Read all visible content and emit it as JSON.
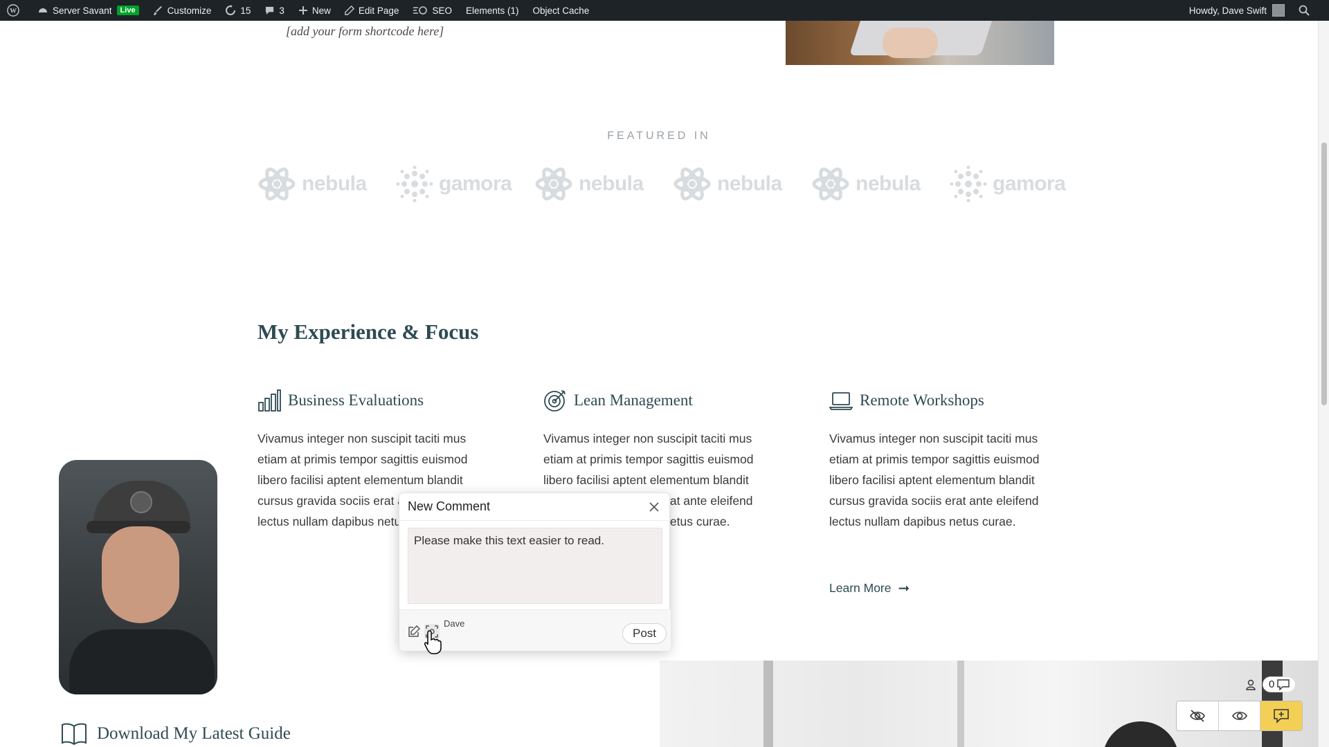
{
  "admin_bar": {
    "site_name": "Server Savant",
    "live_badge": "Live",
    "customize": "Customize",
    "updates_count": "15",
    "comments_count": "3",
    "new_label": "New",
    "edit_page": "Edit Page",
    "seo": "SEO",
    "elements": "Elements (1)",
    "object_cache": "Object Cache",
    "greeting": "Howdy, Dave Swift"
  },
  "page": {
    "shortcode_placeholder": "[add your form shortcode here]",
    "featured_title": "FEATURED IN",
    "logos": [
      "nebula",
      "gamora",
      "nebula",
      "nebula",
      "nebula",
      "gamora"
    ],
    "experience_heading": "My Experience & Focus",
    "columns": [
      {
        "icon": "bar-chart-icon",
        "title": "Business Evaluations",
        "body": "Vivamus integer non suscipit taciti mus etiam at primis tempor sagittis euismod libero facilisi aptent elementum blandit cursus gravida sociis erat ante eleifend lectus nullam dapibus netus curae."
      },
      {
        "icon": "target-icon",
        "title": "Lean Management",
        "body": "Vivamus integer non suscipit taciti mus etiam at primis tempor sagittis euismod libero facilisi aptent elementum blandit cursus gravida sociis erat ante eleifend lectus nullam dapibus netus curae."
      },
      {
        "icon": "laptop-icon",
        "title": "Remote Workshops",
        "body": "Vivamus integer non suscipit taciti mus etiam at primis tempor sagittis euismod libero facilisi aptent elementum blandit cursus gravida sociis erat ante eleifend lectus nullam dapibus netus curae."
      }
    ],
    "learn_more": "Learn More",
    "guide_title": "Download My Latest Guide"
  },
  "comment_popup": {
    "title": "New Comment",
    "text": "Please make this text easier to read.",
    "user": "Dave",
    "post_label": "Post"
  },
  "comment_tools": {
    "count": "0"
  },
  "colors": {
    "admin_bar": "#1d2327",
    "accent_heading": "#2e4a52",
    "live_badge": "#00a32a",
    "active_tool": "#f3cf55"
  }
}
